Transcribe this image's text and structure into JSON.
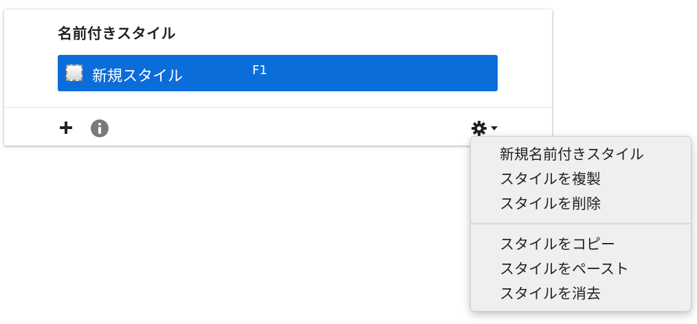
{
  "panel": {
    "title": "名前付きスタイル",
    "styles": [
      {
        "name": "新規スタイル",
        "shortcut": "F1",
        "selected": true
      }
    ]
  },
  "footer": {
    "add_icon": "plus-icon",
    "info_icon": "info-icon",
    "gear_icon": "gear-icon",
    "dropdown_icon": "caret-down-icon"
  },
  "menu": {
    "items": [
      "新規名前付きスタイル",
      "スタイルを複製",
      "スタイルを削除",
      "スタイルをコピー",
      "スタイルをペースト",
      "スタイルを消去"
    ]
  },
  "colors": {
    "selection": "#0b6dd9",
    "menu_bg": "#efefef"
  }
}
